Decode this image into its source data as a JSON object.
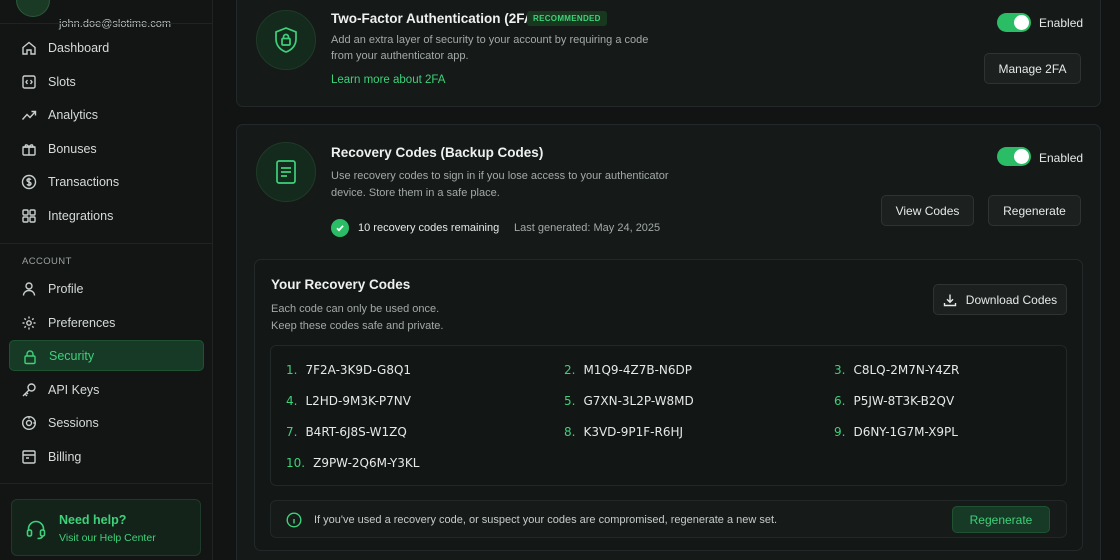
{
  "user": {
    "email": "john.doe@slotime.com"
  },
  "nav": {
    "main": [
      {
        "label": "Dashboard",
        "icon": "home-icon"
      },
      {
        "label": "Slots",
        "icon": "code-icon"
      },
      {
        "label": "Analytics",
        "icon": "trend-icon"
      },
      {
        "label": "Bonuses",
        "icon": "gift-icon"
      },
      {
        "label": "Transactions",
        "icon": "dollar-icon"
      },
      {
        "label": "Integrations",
        "icon": "grid-icon"
      }
    ],
    "account_label": "ACCOUNT",
    "account": [
      {
        "label": "Profile",
        "icon": "user-icon"
      },
      {
        "label": "Preferences",
        "icon": "gear-icon"
      },
      {
        "label": "Security",
        "icon": "lock-icon",
        "active": true
      },
      {
        "label": "API Keys",
        "icon": "key-icon"
      },
      {
        "label": "Sessions",
        "icon": "sessions-icon"
      },
      {
        "label": "Billing",
        "icon": "billing-icon"
      }
    ],
    "help": {
      "title": "Need help?",
      "link": "Visit our Help Center"
    }
  },
  "twofa": {
    "title": "Two-Factor Authentication (2FA)",
    "badge": "RECOMMENDED",
    "desc_line1": "Add an extra layer of security to your account by requiring a code",
    "desc_line2": "from your authenticator app.",
    "link": "Learn more about 2FA",
    "toggle_label": "Enabled",
    "manage_button": "Manage 2FA"
  },
  "recovery": {
    "title": "Recovery Codes (Backup Codes)",
    "desc_line1": "Use recovery codes to sign in if you lose access to your authenticator",
    "desc_line2": "device. Store them in a safe place.",
    "toggle_label": "Enabled",
    "remaining": "10 recovery codes remaining",
    "last_generated": "Last generated: May 24, 2025",
    "view_button": "View Codes",
    "regenerate_button": "Regenerate"
  },
  "codes_panel": {
    "title": "Your Recovery Codes",
    "desc_line1": "Each code can only be used once.",
    "desc_line2": "Keep these codes safe and private.",
    "download_button": "Download Codes",
    "codes": [
      {
        "num": "1.",
        "code": "7F2A-3K9D-G8Q1"
      },
      {
        "num": "2.",
        "code": "M1Q9-4Z7B-N6DP"
      },
      {
        "num": "3.",
        "code": "C8LQ-2M7N-Y4ZR"
      },
      {
        "num": "4.",
        "code": "L2HD-9M3K-P7NV"
      },
      {
        "num": "5.",
        "code": "G7XN-3L2P-W8MD"
      },
      {
        "num": "6.",
        "code": "P5JW-8T3K-B2QV"
      },
      {
        "num": "7.",
        "code": "B4RT-6J8S-W1ZQ"
      },
      {
        "num": "8.",
        "code": "K3VD-9P1F-R6HJ"
      },
      {
        "num": "9.",
        "code": "D6NY-1G7M-X9PL"
      },
      {
        "num": "10.",
        "code": "Z9PW-2Q6M-Y3KL"
      }
    ],
    "notice": "If you've used a recovery code, or suspect your codes are compromised, regenerate a new set.",
    "notice_button": "Regenerate"
  },
  "colors": {
    "accent": "#3ed17a",
    "background": "#111413",
    "card": "#151918"
  }
}
